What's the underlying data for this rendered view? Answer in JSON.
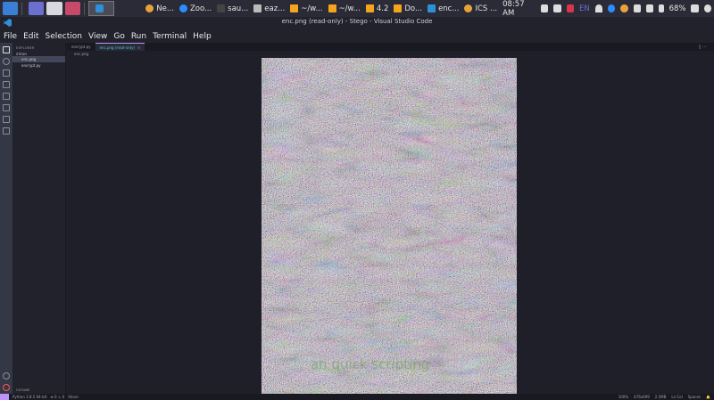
{
  "taskbar": {
    "apps": [
      {
        "label": "Ne...",
        "color": "#e8a23b"
      },
      {
        "label": "Zoo...",
        "color": "#2d8cff"
      },
      {
        "label": "sau...",
        "color": "#cccccc"
      },
      {
        "label": "eaz...",
        "color": "#cccccc"
      },
      {
        "label": "~/w...",
        "color": "#f4a51c"
      },
      {
        "label": "~/w...",
        "color": "#f4a51c"
      },
      {
        "label": "4.2",
        "color": "#f4a51c"
      },
      {
        "label": "Do...",
        "color": "#f4a51c"
      },
      {
        "label": "enc...",
        "color": "#2f8fd9"
      },
      {
        "label": "ICS ...",
        "color": "#e8a23b"
      }
    ],
    "clock": "08:57 AM",
    "language": "EN",
    "battery": "68%"
  },
  "window": {
    "title": "enc.png (read-only) - Stego - Visual Studio Code"
  },
  "menu": [
    "File",
    "Edit",
    "Selection",
    "View",
    "Go",
    "Run",
    "Terminal",
    "Help"
  ],
  "sidebar": {
    "header": "EXPLORER",
    "section": "STEGO",
    "files": [
      "enc.png",
      "encrypt.py"
    ],
    "outline": "OUTLINE"
  },
  "tabs": [
    {
      "label": "encrypt.py",
      "active": false
    },
    {
      "label": "enc.png (read-only)",
      "active": true
    }
  ],
  "breadcrumb": "enc.png",
  "image_overlay_text": "an quick scripting",
  "statusbar": {
    "left": [
      "Python 3.8.5 64-bit",
      "⊗ 0 ⚠ 0",
      "Share"
    ],
    "right": [
      "100%",
      "476x699",
      "2.5MB",
      "Ln Col",
      "Spaces"
    ]
  }
}
